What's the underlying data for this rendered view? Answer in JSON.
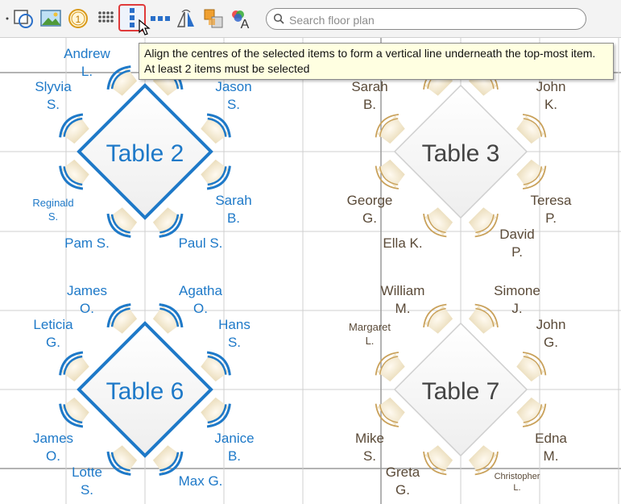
{
  "search": {
    "placeholder": "Search floor plan"
  },
  "toolbar": {
    "icons": [
      "shape-tools-icon",
      "image-icon",
      "number-badge-icon",
      "grid-dots-icon",
      "align-vertical-icon",
      "align-horizontal-icon",
      "flip-icon",
      "arrange-icon",
      "color-text-icon"
    ],
    "number_badge": "1"
  },
  "tooltip": {
    "line1": "Align the centres of the selected items to form a vertical line underneath the top-most item.",
    "line2": "At least 2 items must be selected"
  },
  "tables": [
    {
      "label": "Table 2",
      "style": "selected",
      "color": "#1e79c8"
    },
    {
      "label": "Table 3",
      "style": "normal",
      "color": "#c9a15a"
    },
    {
      "label": "Table 6",
      "style": "selected",
      "color": "#1e79c8"
    },
    {
      "label": "Table 7",
      "style": "normal",
      "color": "#c9a15a"
    }
  ],
  "guests": {
    "t2": [
      "Andrew\nL.",
      "Slyvia\nS.",
      "Jason\nS.",
      "Reginald\nS.",
      "Sarah\nB.",
      "Pam S.",
      "Paul S."
    ],
    "t3": [
      "Sarah\nB.",
      "John\nK.",
      "George\nG.",
      "Teresa\nP.",
      "Ella K.",
      "David\nP."
    ],
    "t6": [
      "James\nO.",
      "Agatha\nO.",
      "Leticia\nG.",
      "Hans\nS.",
      "James\nO.",
      "Janice\nB.",
      "Lotte\nS.",
      "Max G."
    ],
    "t7": [
      "William\nM.",
      "Simone\nJ.",
      "Margaret\nL.",
      "John\nG.",
      "Mike\nS.",
      "Edna\nM.",
      "Greta\nG.",
      "Christopher\nL."
    ]
  },
  "colors": {
    "selected": "#1e79c8",
    "normal_outline": "#c9a15a",
    "chair_fill": "#f3ead2",
    "grid": "#cfcfcf",
    "tooltip_bg": "#ffffe1"
  }
}
